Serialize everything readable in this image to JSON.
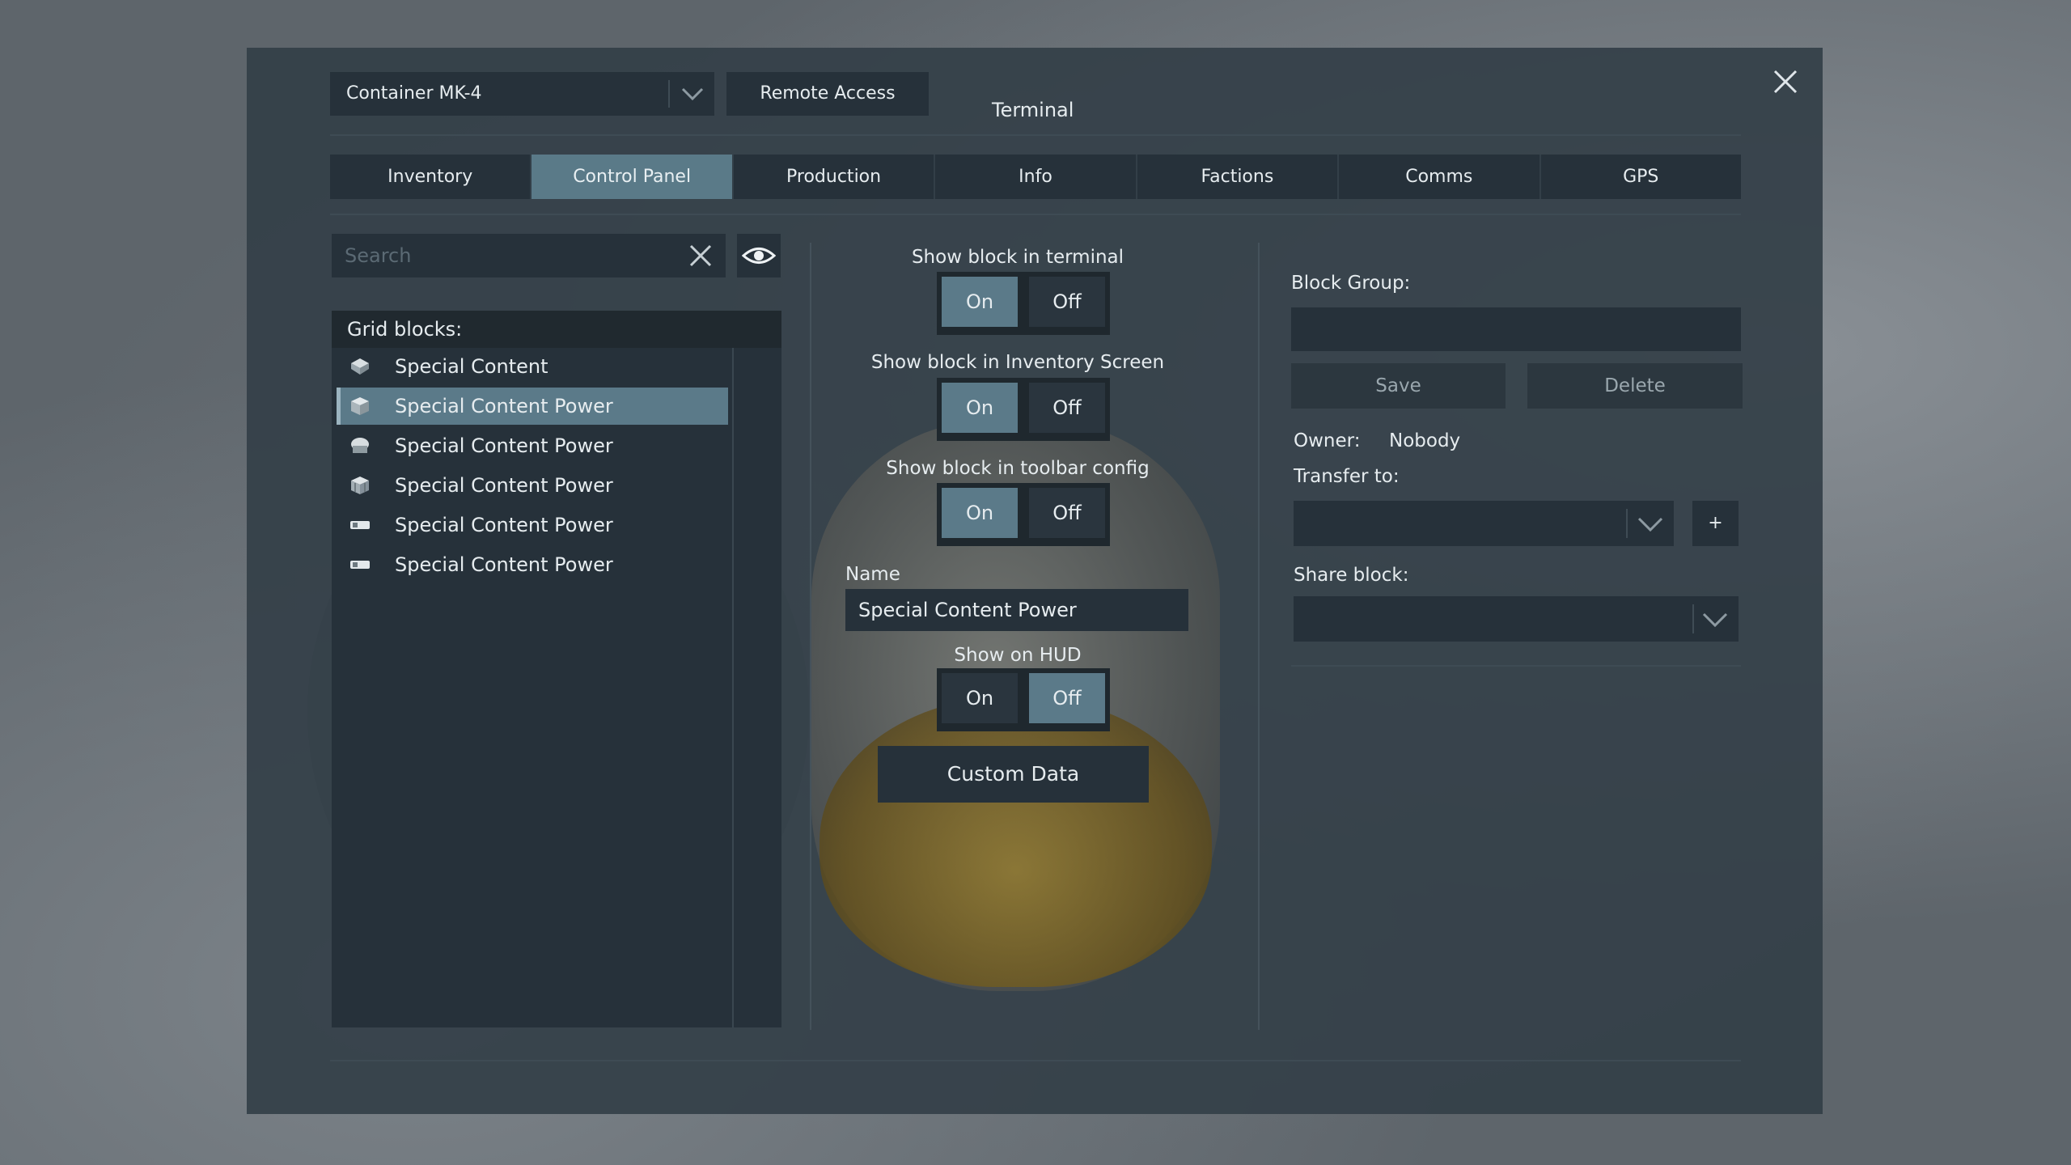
{
  "window": {
    "title": "Terminal",
    "close_icon": "close-icon"
  },
  "toolbar": {
    "container_select": {
      "value": "Container MK-4"
    },
    "remote_access_label": "Remote Access"
  },
  "tabs": [
    {
      "label": "Inventory",
      "active": false
    },
    {
      "label": "Control Panel",
      "active": true
    },
    {
      "label": "Production",
      "active": false
    },
    {
      "label": "Info",
      "active": false
    },
    {
      "label": "Factions",
      "active": false
    },
    {
      "label": "Comms",
      "active": false
    },
    {
      "label": "GPS",
      "active": false
    }
  ],
  "search": {
    "placeholder": "Search"
  },
  "grid_blocks": {
    "title": "Grid blocks:",
    "items": [
      {
        "label": "Special Content",
        "icon": "gem-block-icon",
        "selected": false
      },
      {
        "label": "Special Content Power",
        "icon": "cube-block-icon",
        "selected": true
      },
      {
        "label": "Special Content Power",
        "icon": "dome-block-icon",
        "selected": false
      },
      {
        "label": "Special Content Power",
        "icon": "crate-block-icon",
        "selected": false
      },
      {
        "label": "Special Content Power",
        "icon": "panel-block-icon",
        "selected": false
      },
      {
        "label": "Special Content Power",
        "icon": "panel-block-icon",
        "selected": false
      }
    ]
  },
  "controls": {
    "show_in_terminal": {
      "label": "Show block in terminal",
      "on": "On",
      "off": "Off",
      "value": "On"
    },
    "show_in_inventory": {
      "label": "Show block in Inventory Screen",
      "on": "On",
      "off": "Off",
      "value": "On"
    },
    "show_in_toolbar": {
      "label": "Show block in toolbar config",
      "on": "On",
      "off": "Off",
      "value": "On"
    },
    "name": {
      "label": "Name",
      "value": "Special Content Power"
    },
    "show_on_hud": {
      "label": "Show on HUD",
      "on": "On",
      "off": "Off",
      "value": "Off"
    },
    "custom_data_label": "Custom Data"
  },
  "block_group": {
    "label": "Block Group:",
    "value": "",
    "save_label": "Save",
    "delete_label": "Delete"
  },
  "ownership": {
    "owner_label": "Owner:",
    "owner_value": "Nobody",
    "transfer_label": "Transfer to:",
    "transfer_value": "",
    "add_label": "+",
    "share_label": "Share block:",
    "share_value": ""
  },
  "colors": {
    "panel": "#344048",
    "field": "#26313a",
    "active": "#5b7a89"
  }
}
